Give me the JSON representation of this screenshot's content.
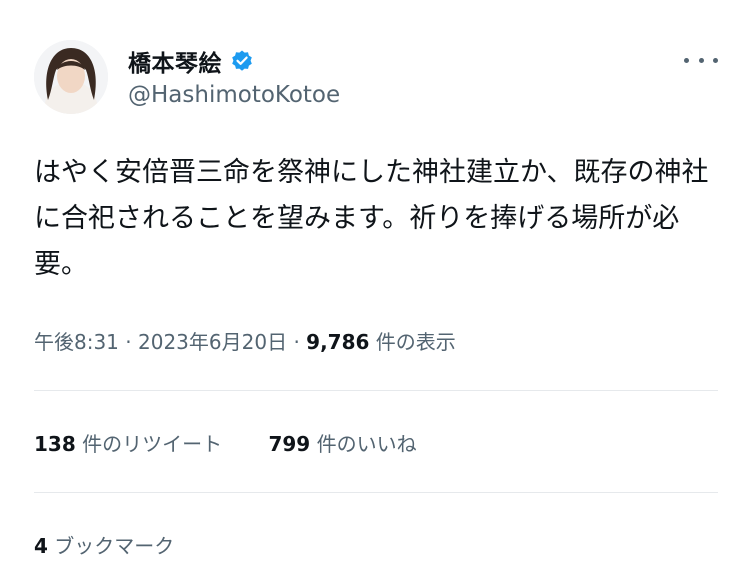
{
  "author": {
    "display_name": "橋本琴絵",
    "handle": "@HashimotoKotoe",
    "verified": true
  },
  "tweet": {
    "text": "はやく安倍晋三命を祭神にした神社建立か、既存の神社に合祀されることを望みます。祈りを捧げる場所が必要。",
    "time": "午後8:31",
    "separator": "·",
    "date": "2023年6月20日",
    "views_count": "9,786",
    "views_label": "件の表示"
  },
  "stats": {
    "retweets_count": "138",
    "retweets_label": "件のリツイート",
    "likes_count": "799",
    "likes_label": "件のいいね",
    "bookmarks_count": "4",
    "bookmarks_label": "ブックマーク"
  },
  "colors": {
    "text": "#0f1419",
    "secondary": "#536471",
    "verified_blue": "#1d9bf0",
    "divider": "#e6e9ec"
  }
}
